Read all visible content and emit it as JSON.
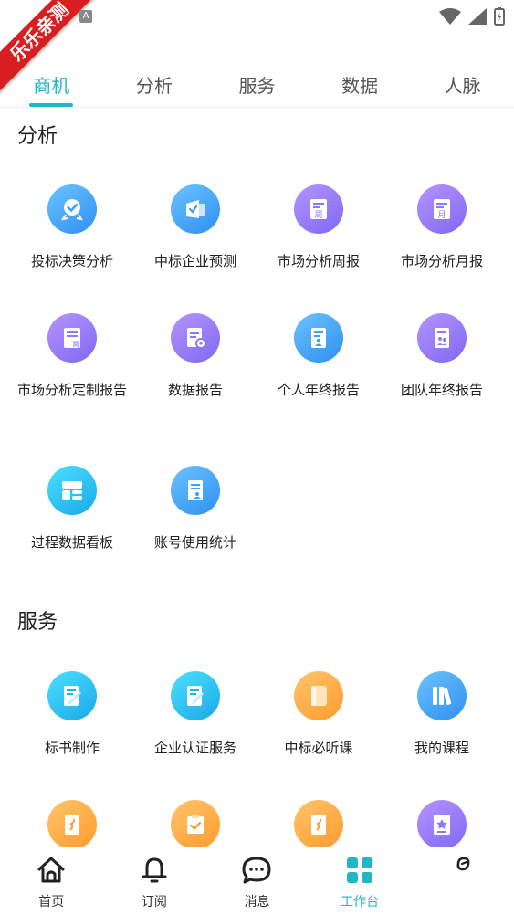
{
  "status": {
    "ribbon": "乐乐亲测",
    "a_badge": "A"
  },
  "tabs": [
    {
      "label": "商机",
      "active": true
    },
    {
      "label": "分析",
      "active": false
    },
    {
      "label": "服务",
      "active": false
    },
    {
      "label": "数据",
      "active": false
    },
    {
      "label": "人脉",
      "active": false
    }
  ],
  "analysis": {
    "title": "分析",
    "items": [
      {
        "label": "投标决策分析",
        "icon": "badge-check-icon",
        "color": "#3f9ff3"
      },
      {
        "label": "中标企业预测",
        "icon": "box-check-icon",
        "color": "#3f9ff3"
      },
      {
        "label": "市场分析周报",
        "icon": "weekly-report-icon",
        "color": "#8f78f6"
      },
      {
        "label": "市场分析月报",
        "icon": "monthly-report-icon",
        "color": "#8f78f6"
      },
      {
        "label": "市场分析定制报告",
        "icon": "custom-report-icon",
        "color": "#8f78f6"
      },
      {
        "label": "数据报告",
        "icon": "data-report-icon",
        "color": "#8f78f6"
      },
      {
        "label": "个人年终报告",
        "icon": "personal-report-icon",
        "color": "#3f9ff3"
      },
      {
        "label": "团队年终报告",
        "icon": "team-report-icon",
        "color": "#8f78f6"
      },
      {
        "label": "过程数据看板",
        "icon": "dashboard-icon",
        "color": "#22b6e8"
      },
      {
        "label": "账号使用统计",
        "icon": "account-stats-icon",
        "color": "#3f9ff3"
      }
    ]
  },
  "service": {
    "title": "服务",
    "items": [
      {
        "label": "标书制作",
        "icon": "edit-doc-icon",
        "color": "#22b6e8"
      },
      {
        "label": "企业认证服务",
        "icon": "certify-doc-icon",
        "color": "#22b6e8"
      },
      {
        "label": "中标必听课",
        "icon": "course-book-icon",
        "color": "#ffa53c"
      },
      {
        "label": "我的课程",
        "icon": "library-icon",
        "color": "#3f9ff3"
      },
      {
        "label": "",
        "icon": "doc-orange-icon",
        "color": "#ffa53c"
      },
      {
        "label": "",
        "icon": "check-doc-orange-icon",
        "color": "#ffa53c"
      },
      {
        "label": "",
        "icon": "doc-orange-icon",
        "color": "#ffa53c"
      },
      {
        "label": "",
        "icon": "star-doc-icon",
        "color": "#8f78f6"
      }
    ]
  },
  "bottom_nav": [
    {
      "label": "首页",
      "icon": "home-icon",
      "active": false
    },
    {
      "label": "订阅",
      "icon": "bell-icon",
      "active": false
    },
    {
      "label": "消息",
      "icon": "chat-icon",
      "active": false
    },
    {
      "label": "工作台",
      "icon": "grid-icon",
      "active": true
    },
    {
      "label": "",
      "icon": "me-icon",
      "active": false
    }
  ],
  "colors": {
    "accent": "#22b6c9"
  }
}
